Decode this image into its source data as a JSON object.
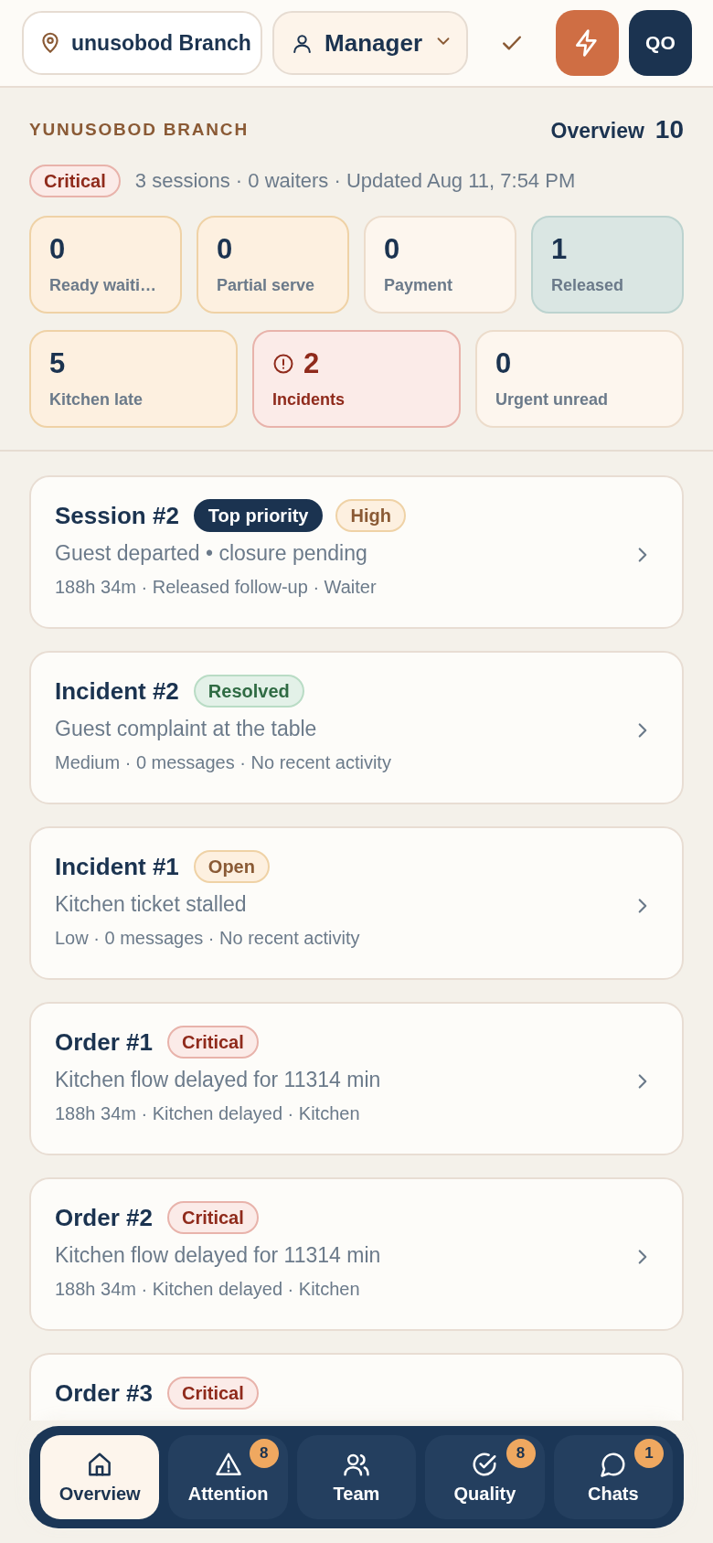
{
  "header": {
    "branch_field": {
      "value": "unusobod Branch"
    },
    "role_select": {
      "value": "Manager"
    },
    "avatar": "QO"
  },
  "summary": {
    "branch_name": "YUNUSOBOD BRANCH",
    "view_label": "Overview",
    "view_count": "10",
    "status_badge": "Critical",
    "status_text": "3 sessions · 0 waiters · Updated Aug 11, 7:54 PM",
    "stats": [
      {
        "value": "0",
        "label": "Ready waiti…",
        "kind": "warm"
      },
      {
        "value": "0",
        "label": "Partial serve",
        "kind": "warm"
      },
      {
        "value": "0",
        "label": "Payment",
        "kind": "plain"
      },
      {
        "value": "1",
        "label": "Released",
        "kind": "calm"
      },
      {
        "value": "5",
        "label": "Kitchen late",
        "kind": "warm"
      },
      {
        "value": "2",
        "label": "Incidents",
        "kind": "alert"
      },
      {
        "value": "0",
        "label": "Urgent unread",
        "kind": "plain"
      }
    ]
  },
  "cards": [
    {
      "title": "Session #2",
      "badges": [
        {
          "text": "Top priority",
          "kind": "dark"
        },
        {
          "text": "High",
          "kind": "high"
        }
      ],
      "summary": "Guest departed • closure pending",
      "meta": "188h 34m · Released follow-up · Waiter"
    },
    {
      "title": "Incident #2",
      "badges": [
        {
          "text": "Resolved",
          "kind": "resolved"
        }
      ],
      "summary": "Guest complaint at the table",
      "meta": "Medium · 0 messages · No recent activity"
    },
    {
      "title": "Incident #1",
      "badges": [
        {
          "text": "Open",
          "kind": "high"
        }
      ],
      "summary": "Kitchen ticket stalled",
      "meta": "Low · 0 messages · No recent activity"
    },
    {
      "title": "Order #1",
      "badges": [
        {
          "text": "Critical",
          "kind": "critical"
        }
      ],
      "summary": "Kitchen flow delayed for 11314 min",
      "meta": "188h 34m · Kitchen delayed · Kitchen"
    },
    {
      "title": "Order #2",
      "badges": [
        {
          "text": "Critical",
          "kind": "critical"
        }
      ],
      "summary": "Kitchen flow delayed for 11314 min",
      "meta": "188h 34m · Kitchen delayed · Kitchen"
    },
    {
      "title": "Order #3",
      "badges": [
        {
          "text": "Critical",
          "kind": "critical"
        }
      ]
    }
  ],
  "nav": {
    "items": [
      {
        "label": "Overview",
        "kind": "home",
        "selected": true
      },
      {
        "label": "Attention",
        "kind": "alert",
        "selected": false,
        "count": "8"
      },
      {
        "label": "Team",
        "kind": "users",
        "selected": false
      },
      {
        "label": "Quality",
        "kind": "check",
        "selected": false,
        "count": "8"
      },
      {
        "label": "Chats",
        "kind": "chat",
        "selected": false,
        "count": "1"
      }
    ]
  }
}
